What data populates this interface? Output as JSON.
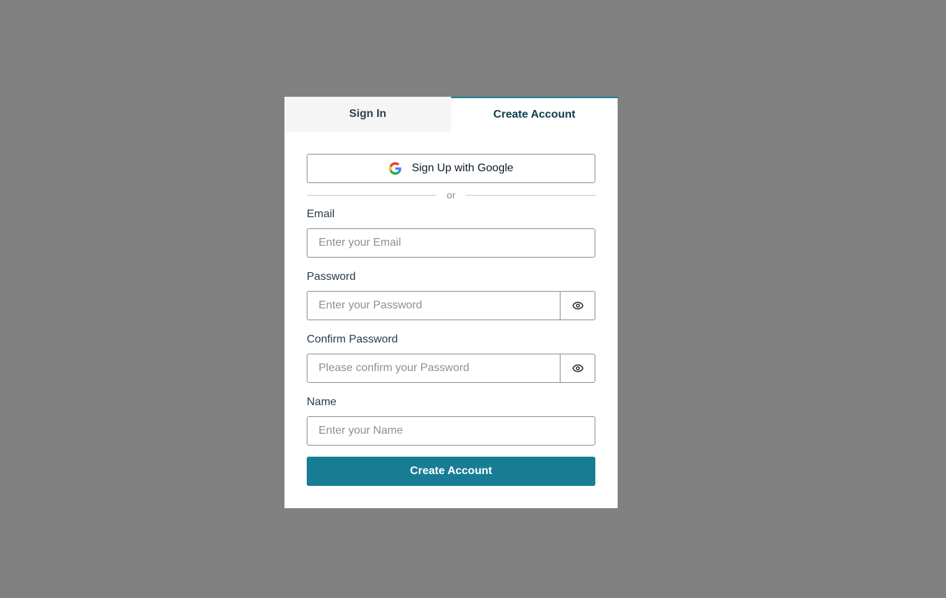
{
  "tabs": [
    {
      "label": "Sign In",
      "active": false
    },
    {
      "label": "Create Account",
      "active": true
    }
  ],
  "google_button": {
    "label": "Sign Up with Google",
    "icon": "google-icon"
  },
  "divider_text": "or",
  "fields": {
    "email": {
      "label": "Email",
      "placeholder": "Enter your Email",
      "value": ""
    },
    "password": {
      "label": "Password",
      "placeholder": "Enter your Password",
      "value": "",
      "toggle_icon": "eye-icon"
    },
    "confirm_password": {
      "label": "Confirm Password",
      "placeholder": "Please confirm your Password",
      "value": "",
      "toggle_icon": "eye-icon"
    },
    "name": {
      "label": "Name",
      "placeholder": "Enter your Name",
      "value": ""
    }
  },
  "submit_label": "Create Account",
  "colors": {
    "accent": "#187c95",
    "backdrop": "#808080"
  }
}
